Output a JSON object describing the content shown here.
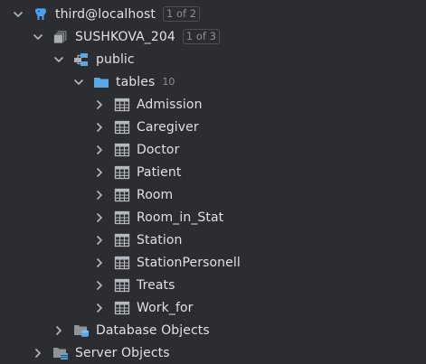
{
  "tree": {
    "connection": {
      "label": "third@localhost",
      "badge": "1 of 2"
    },
    "database": {
      "label": "SUSHKOVA_204",
      "badge": "1 of 3"
    },
    "schema": {
      "label": "public"
    },
    "tables_folder": {
      "label": "tables",
      "count": "10"
    },
    "tables": [
      "Admission",
      "Caregiver",
      "Doctor",
      "Patient",
      "Room",
      "Room_in_Stat",
      "Station",
      "StationPersonell",
      "Treats",
      "Work_for"
    ],
    "database_objects": {
      "label": "Database Objects"
    },
    "server_objects": {
      "label": "Server Objects"
    }
  },
  "colors": {
    "background": "#2b2d30",
    "text": "#dfe1e5",
    "muted": "#8b8f96",
    "elephant_blue": "#4a9ff5",
    "folder_blue": "#5aa9e6"
  }
}
